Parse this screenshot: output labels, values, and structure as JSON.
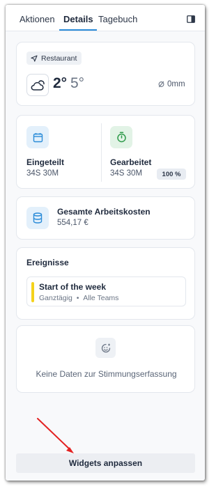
{
  "tabs": [
    {
      "label": "Aktionen",
      "active": false
    },
    {
      "label": "Details",
      "active": true
    },
    {
      "label": "Tagebuch",
      "active": false
    }
  ],
  "location": {
    "label": "Restaurant",
    "icon": "navigation-arrow-icon"
  },
  "weather": {
    "icon": "cloud-sun-icon",
    "temp_high": "2°",
    "temp_low": "5°",
    "precipitation": "0mm",
    "precipitation_icon": "empty-set-icon"
  },
  "scheduled": {
    "label": "Eingeteilt",
    "value": "34S 30M",
    "icon": "calendar-icon",
    "icon_color": "#2a8bd8"
  },
  "worked": {
    "label": "Gearbeitet",
    "value": "34S 30M",
    "percent": "100 %",
    "icon": "stopwatch-icon",
    "icon_color": "#2e9a4a"
  },
  "labor_cost": {
    "label": "Gesamte Arbeitskosten",
    "value": "554,17 €",
    "icon": "database-icon"
  },
  "events": {
    "title": "Ereignisse",
    "items": [
      {
        "title": "Start of the week",
        "duration": "Ganztägig",
        "separator": "•",
        "scope": "Alle Teams",
        "color": "#f4d21b"
      }
    ]
  },
  "mood": {
    "icon": "mood-face-icon",
    "empty_text": "Keine Daten zur Stimmungserfassung"
  },
  "customize_button": {
    "label": "Widgets anpassen"
  },
  "colors": {
    "accent": "#2a8bd8",
    "annotation_arrow": "#e32222"
  }
}
